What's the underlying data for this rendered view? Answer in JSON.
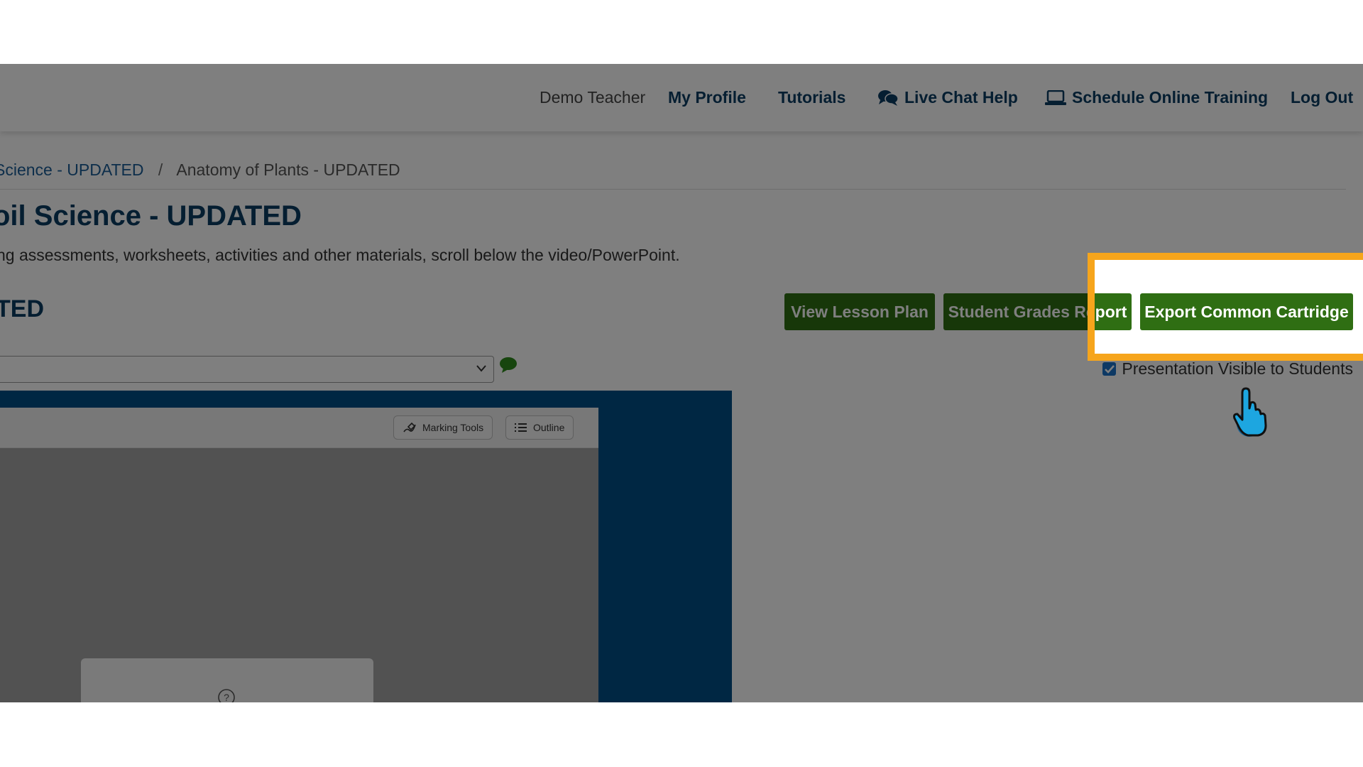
{
  "nav": {
    "user_name": "Demo Teacher",
    "my_profile": "My Profile",
    "tutorials": "Tutorials",
    "live_chat": "Live Chat Help",
    "schedule_training": "Schedule Online Training",
    "log_out": "Log Out"
  },
  "breadcrumb": {
    "parent": "Science - UPDATED",
    "separator": "/",
    "current": "Anatomy of Plants - UPDATED"
  },
  "page": {
    "course_title": "oil Science - UPDATED",
    "description": "ng assessments, worksheets, activities and other materials, scroll below the video/PowerPoint.",
    "lesson_title": "TED"
  },
  "buttons": {
    "view_lesson_plan": "View Lesson Plan",
    "student_grades_report": "Student Grades Report",
    "export_common_cartridge": "Export Common Cartridge"
  },
  "presentation_visible": {
    "label": "Presentation Visible to Students",
    "checked": true
  },
  "viewer": {
    "marking_tools": "Marking Tools",
    "outline": "Outline"
  },
  "colors": {
    "nav_text": "#0b3c63",
    "button_green": "#2f6e13",
    "highlight": "#f6a51c",
    "viewer_blue": "#004e86"
  },
  "icons": [
    "chat-bubbles-icon",
    "laptop-icon",
    "chevron-down-icon",
    "comment-icon",
    "checkmark-icon",
    "marker-icon",
    "list-icon",
    "question-circle-icon",
    "pointer-hand-icon"
  ]
}
